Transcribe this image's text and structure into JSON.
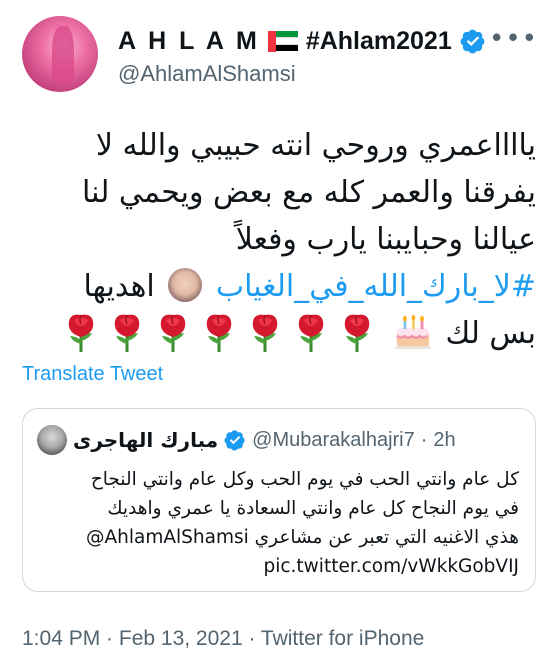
{
  "author": {
    "name": "A H L A M",
    "hashtag_name": "#Ahlam2021",
    "handle": "@AhlamAlShamsi",
    "flag_colors": {
      "red": "#ef3340",
      "green": "#009639",
      "white": "#ffffff",
      "black": "#000000"
    }
  },
  "tweet": {
    "lines": [
      "يااااعمري وروحي انته حبيبي والله لا",
      "يفرقنا والعمر كله مع بعض ويحمي لنا",
      "عيالنا وحبايبنا يارب وفعلاً"
    ],
    "hashtag": "#لا_بارك_الله_في_الغياب",
    "after_hashtag": "اهديها",
    "last_line_text": "بس لك",
    "roses_count": 7
  },
  "translate_label": "Translate Tweet",
  "quote": {
    "name": "مبارك الهاجرى",
    "handle": "@Mubarakalhajri7",
    "separator": "·",
    "time": "2h",
    "lines": [
      "كل عام وانتي الحب في يوم الحب وكل عام وانتي النجاح",
      "في يوم النجاح كل عام وانتي السعادة يا عمري واهديك",
      "هذي الاغنيه التي تعبر عن مشاعري"
    ],
    "mention": "@AhlamAlShamsi",
    "link": "pic.twitter.com/vWkkGobVIJ"
  },
  "footer": "1:04 PM · Feb 13, 2021 · Twitter for iPhone",
  "colors": {
    "link": "#1d9bf0",
    "verified": "#1d9bf0",
    "secondary": "#536471"
  }
}
